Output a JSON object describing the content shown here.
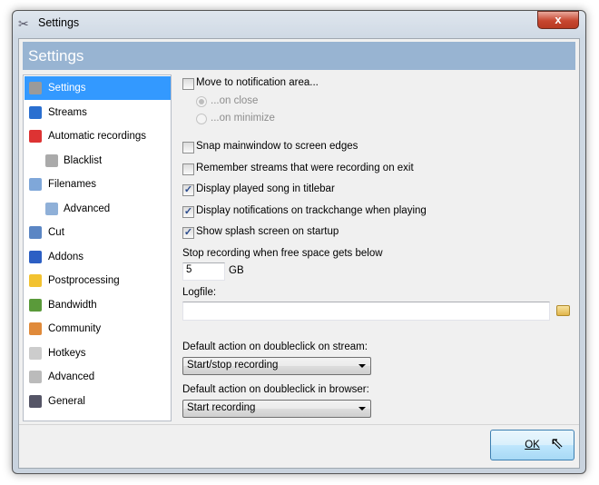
{
  "window": {
    "title": "Settings",
    "close_label": "x"
  },
  "header": {
    "title": "Settings"
  },
  "sidebar": {
    "items": [
      {
        "label": "Settings",
        "icon": "settings-icon",
        "selected": true
      },
      {
        "label": "Streams",
        "icon": "music-note-icon"
      },
      {
        "label": "Automatic recordings",
        "icon": "blocks-icon"
      },
      {
        "label": "Blacklist",
        "icon": "document-icon",
        "sub": true
      },
      {
        "label": "Filenames",
        "icon": "pencil-document-icon"
      },
      {
        "label": "Advanced",
        "icon": "document-gear-icon",
        "sub": true
      },
      {
        "label": "Cut",
        "icon": "scissors-icon"
      },
      {
        "label": "Addons",
        "icon": "puzzle-icon"
      },
      {
        "label": "Postprocessing",
        "icon": "lightning-icon"
      },
      {
        "label": "Bandwidth",
        "icon": "plug-icon"
      },
      {
        "label": "Community",
        "icon": "users-icon"
      },
      {
        "label": "Hotkeys",
        "icon": "key-icon"
      },
      {
        "label": "Advanced",
        "icon": "gear-icon"
      },
      {
        "label": "General",
        "icon": "tools-icon"
      }
    ]
  },
  "options": {
    "move_to_tray": {
      "label": "Move to notification area...",
      "checked": false
    },
    "on_close": {
      "label": "...on close",
      "selected": true
    },
    "on_minimize": {
      "label": "...on minimize",
      "selected": false
    },
    "checks": [
      {
        "label": "Snap mainwindow to screen edges",
        "checked": false
      },
      {
        "label": "Remember streams that were recording on exit",
        "checked": false
      },
      {
        "label": "Display played song in titlebar",
        "checked": true
      },
      {
        "label": "Display notifications on trackchange when playing",
        "checked": true
      },
      {
        "label": "Show splash screen on startup",
        "checked": true
      }
    ],
    "free_space_label": "Stop recording when free space gets below",
    "free_space_value": "5",
    "free_space_unit": "GB",
    "logfile_label": "Logfile:",
    "logfile_value": "",
    "stream_action_label": "Default action on doubleclick on stream:",
    "stream_action_value": "Start/stop recording",
    "browser_action_label": "Default action on doubleclick in browser:",
    "browser_action_value": "Start recording"
  },
  "footer": {
    "ok_label": "OK"
  },
  "colors": {
    "header": "#98b4d2",
    "selected": "#3399ff"
  }
}
